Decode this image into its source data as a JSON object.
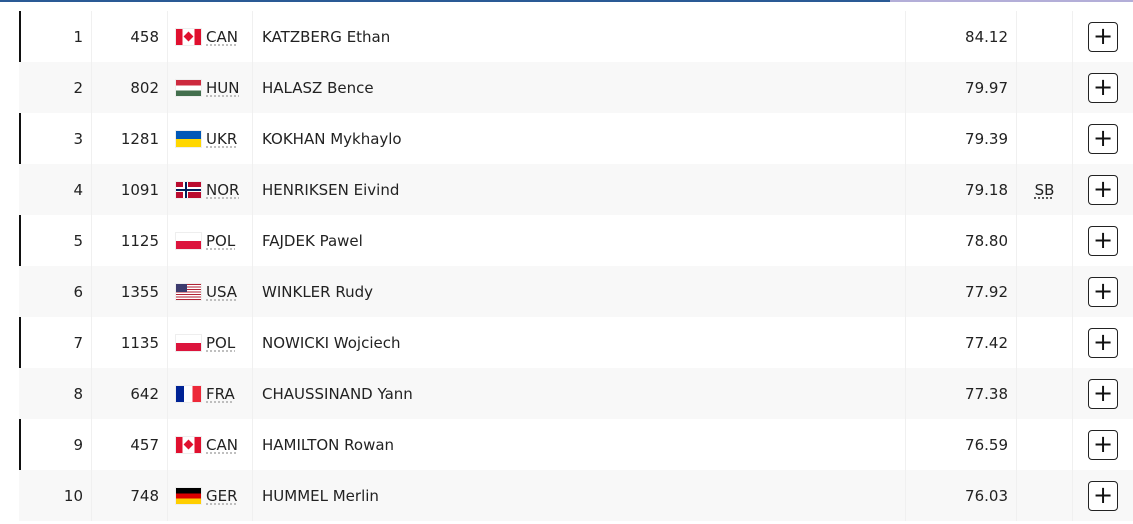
{
  "colors": {
    "accent": "#2a5a95",
    "progress_track": "#b3aed8"
  },
  "results": [
    {
      "rank": "1",
      "bib": "458",
      "country": "CAN",
      "flag": "canada-flag",
      "name": "KATZBERG Ethan",
      "mark": "84.12",
      "note": ""
    },
    {
      "rank": "2",
      "bib": "802",
      "country": "HUN",
      "flag": "hungary-flag",
      "name": "HALASZ Bence",
      "mark": "79.97",
      "note": ""
    },
    {
      "rank": "3",
      "bib": "1281",
      "country": "UKR",
      "flag": "ukraine-flag",
      "name": "KOKHAN Mykhaylo",
      "mark": "79.39",
      "note": ""
    },
    {
      "rank": "4",
      "bib": "1091",
      "country": "NOR",
      "flag": "norway-flag",
      "name": "HENRIKSEN Eivind",
      "mark": "79.18",
      "note": "SB"
    },
    {
      "rank": "5",
      "bib": "1125",
      "country": "POL",
      "flag": "poland-flag",
      "name": "FAJDEK Pawel",
      "mark": "78.80",
      "note": ""
    },
    {
      "rank": "6",
      "bib": "1355",
      "country": "USA",
      "flag": "usa-flag",
      "name": "WINKLER Rudy",
      "mark": "77.92",
      "note": ""
    },
    {
      "rank": "7",
      "bib": "1135",
      "country": "POL",
      "flag": "poland-flag",
      "name": "NOWICKI Wojciech",
      "mark": "77.42",
      "note": ""
    },
    {
      "rank": "8",
      "bib": "642",
      "country": "FRA",
      "flag": "france-flag",
      "name": "CHAUSSINAND Yann",
      "mark": "77.38",
      "note": ""
    },
    {
      "rank": "9",
      "bib": "457",
      "country": "CAN",
      "flag": "canada-flag",
      "name": "HAMILTON Rowan",
      "mark": "76.59",
      "note": ""
    },
    {
      "rank": "10",
      "bib": "748",
      "country": "GER",
      "flag": "germany-flag",
      "name": "HUMMEL Merlin",
      "mark": "76.03",
      "note": ""
    }
  ],
  "expand_label": "+"
}
